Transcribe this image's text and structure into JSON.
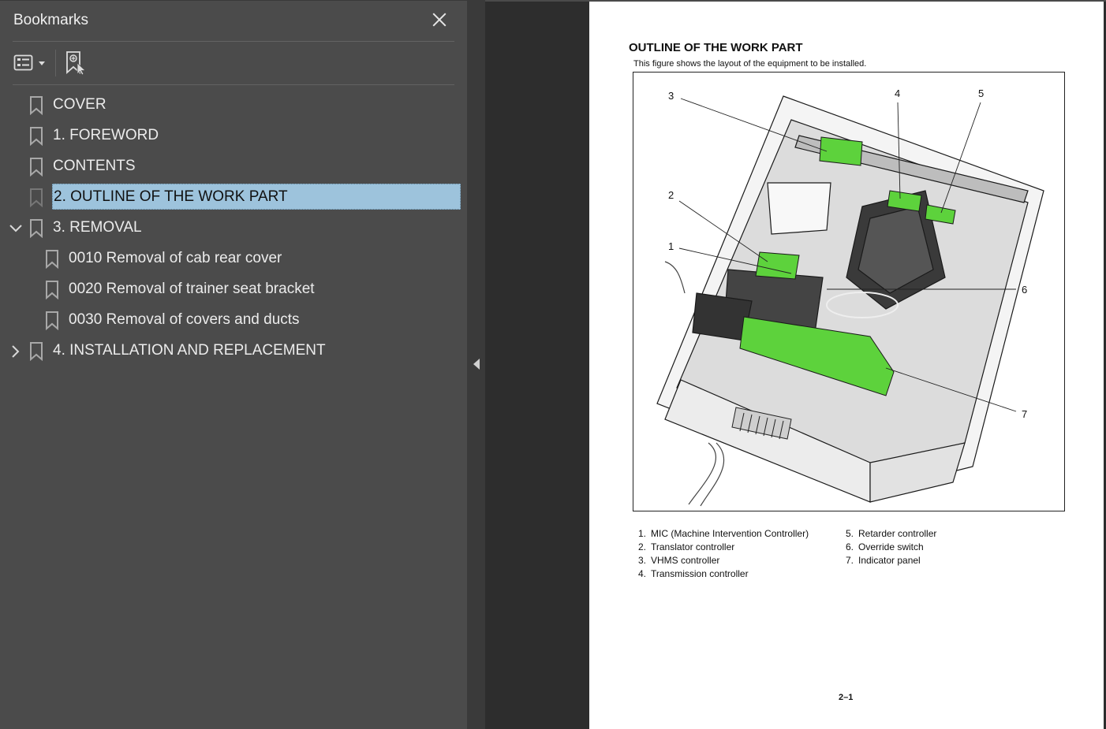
{
  "panel": {
    "title": "Bookmarks",
    "close_icon": "close-icon",
    "options_icon": "list-options-icon",
    "add_bookmark_icon": "new-bookmark-icon"
  },
  "bookmarks": [
    {
      "label": "COVER",
      "level": 0,
      "expander": "none"
    },
    {
      "label": "1. FOREWORD",
      "level": 0,
      "expander": "none"
    },
    {
      "label": "CONTENTS",
      "level": 0,
      "expander": "none"
    },
    {
      "label": "2. OUTLINE OF THE WORK PART",
      "level": 0,
      "expander": "none",
      "selected": true
    },
    {
      "label": "3. REMOVAL",
      "level": 0,
      "expander": "expanded"
    },
    {
      "label": "0010 Removal of cab rear cover",
      "level": 1,
      "expander": "none"
    },
    {
      "label": "0020 Removal of trainer seat bracket",
      "level": 1,
      "expander": "none"
    },
    {
      "label": "0030 Removal of covers and ducts",
      "level": 1,
      "expander": "none"
    },
    {
      "label": "4. INSTALLATION AND REPLACEMENT",
      "level": 0,
      "expander": "collapsed"
    }
  ],
  "document": {
    "title": "OUTLINE OF THE WORK PART",
    "subtitle": "This figure shows the layout of the equipment to be installed.",
    "callouts": [
      "3",
      "4",
      "5",
      "2",
      "1",
      "6",
      "7"
    ],
    "legend_left": [
      {
        "n": "1.",
        "text": "MIC (Machine Intervention Controller)"
      },
      {
        "n": "2.",
        "text": "Translator controller"
      },
      {
        "n": "3.",
        "text": "VHMS controller"
      },
      {
        "n": "4.",
        "text": "Transmission controller"
      }
    ],
    "legend_right": [
      {
        "n": "5.",
        "text": "Retarder controller"
      },
      {
        "n": "6.",
        "text": "Override switch"
      },
      {
        "n": "7.",
        "text": "Indicator panel"
      }
    ],
    "page_number": "2–1"
  },
  "colors": {
    "panel_bg": "#4b4b4b",
    "selection": "#9dc3dc",
    "highlight_green": "#5dd23c"
  }
}
